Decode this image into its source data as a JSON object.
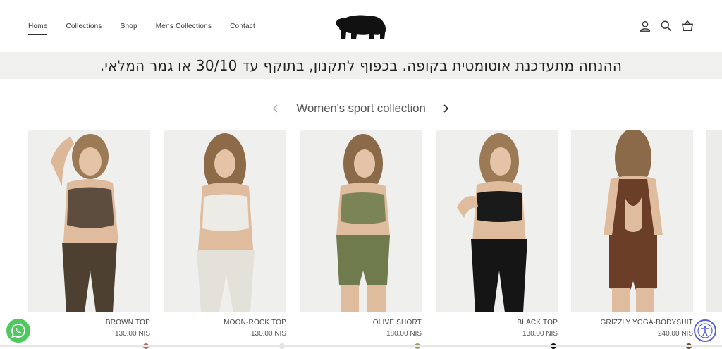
{
  "nav": {
    "items": [
      {
        "label": "Home",
        "active": true
      },
      {
        "label": "Collections",
        "active": false
      },
      {
        "label": "Shop",
        "active": false
      },
      {
        "label": "Mens Collections",
        "active": false
      },
      {
        "label": "Contact",
        "active": false
      }
    ]
  },
  "header_icons": [
    "account-icon",
    "search-icon",
    "cart-icon"
  ],
  "promo": {
    "text": "ההנחה מתעדכנת אוטומטית בקופה. בכפוף לתקנון, בתוקף עד 30/10 או גמר המלאי."
  },
  "collection": {
    "title": "Women's sport collection"
  },
  "products": [
    {
      "name": "BROWN TOP",
      "price": "130.00 NIS",
      "top_color": "#5d4d3e",
      "bottom_color": "#4e4030",
      "swatch": "#b06f5c"
    },
    {
      "name": "MOON-ROCK TOP",
      "price": "130.00 NIS",
      "top_color": "#ecebe6",
      "bottom_color": "#e3e1da",
      "swatch": "#e0e0e0"
    },
    {
      "name": "OLIVE SHORT",
      "price": "180.00 NIS",
      "top_color": "#7b8457",
      "bottom_color": "#6f7a4d",
      "swatch": "#9ea05e"
    },
    {
      "name": "BLACK TOP",
      "price": "130.00 NIS",
      "top_color": "#1a1a1a",
      "bottom_color": "#151515",
      "swatch": "#111111"
    },
    {
      "name": "GRIZZLY YOGA-BODYSUIT",
      "price": "240.00 NIS",
      "top_color": "#6b3e27",
      "bottom_color": "#6b3e27",
      "swatch": "#6c4e35"
    }
  ],
  "colors": {
    "promo_bg": "#f0f0ef",
    "whatsapp": "#4ec85f",
    "accessibility": "#5b5fd6"
  }
}
